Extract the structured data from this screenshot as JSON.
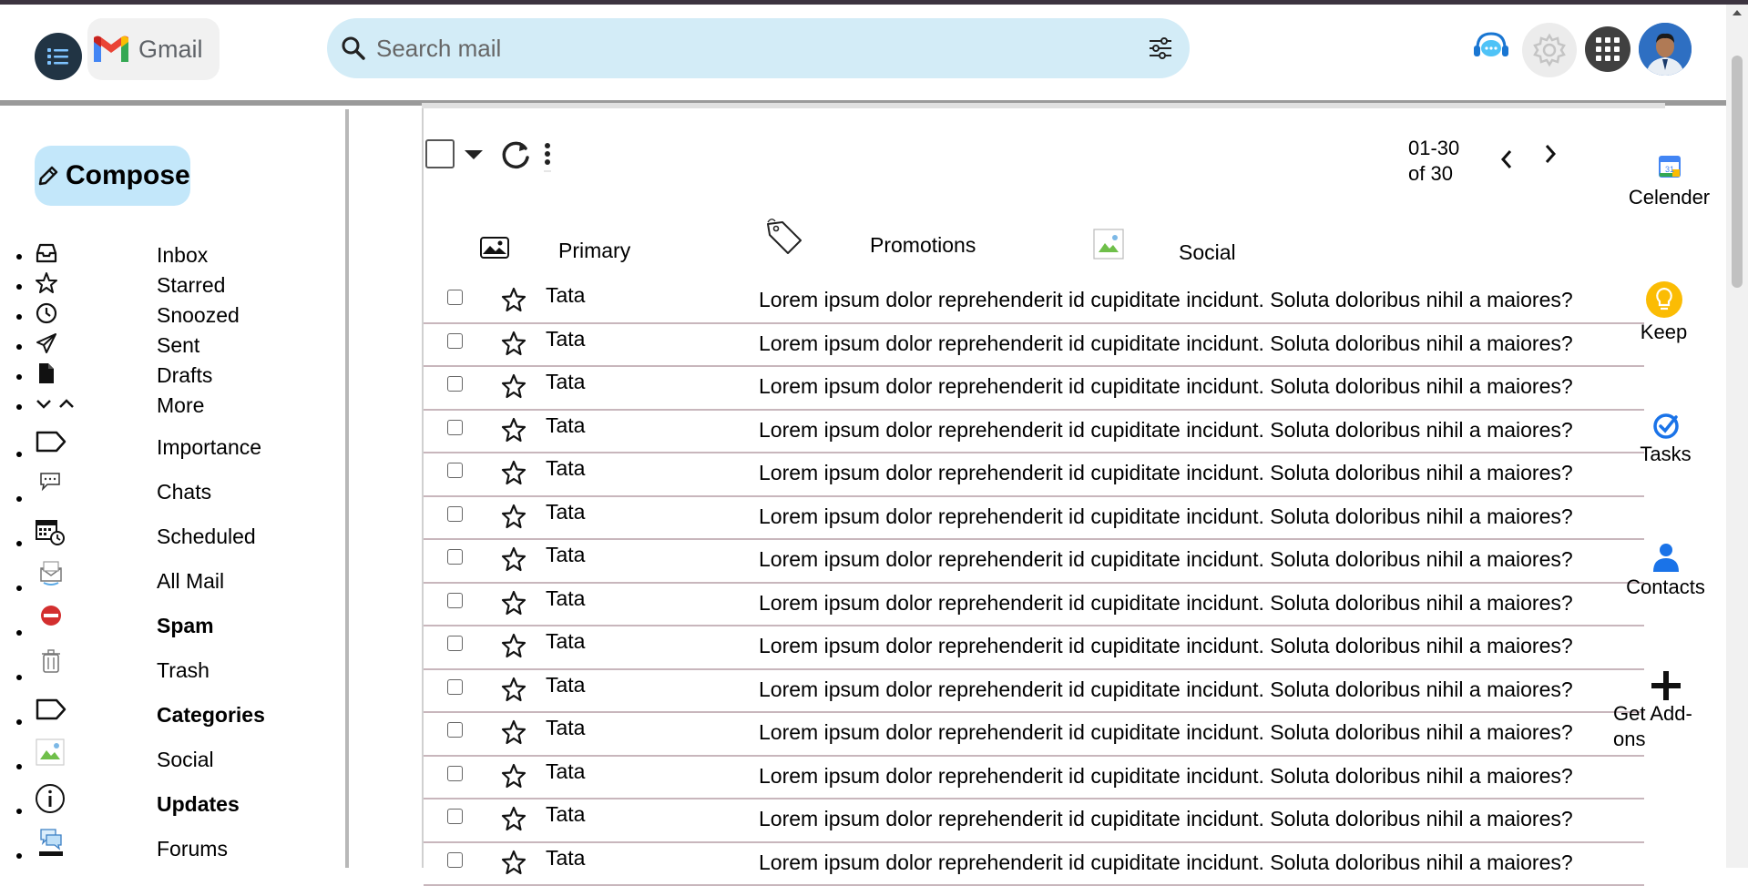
{
  "app": {
    "logo_text": "Gmail"
  },
  "search": {
    "placeholder": "Search mail",
    "value": ""
  },
  "compose": {
    "label": "Compose"
  },
  "sidebar": {
    "items": [
      {
        "label": "Inbox",
        "icon": "inbox-icon",
        "bold": false
      },
      {
        "label": "Starred",
        "icon": "star-icon",
        "bold": false
      },
      {
        "label": "Snoozed",
        "icon": "clock-icon",
        "bold": false
      },
      {
        "label": "Sent",
        "icon": "send-icon",
        "bold": false
      },
      {
        "label": "Drafts",
        "icon": "file-icon",
        "bold": false
      },
      {
        "label": "More",
        "icon": "chevron-toggle-icon",
        "bold": false
      },
      {
        "label": "Importance",
        "icon": "label-icon",
        "bold": false
      },
      {
        "label": "Chats",
        "icon": "chat-icon",
        "bold": false
      },
      {
        "label": "Scheduled",
        "icon": "calendar-clock-icon",
        "bold": false
      },
      {
        "label": "All Mail",
        "icon": "all-mail-icon",
        "bold": false
      },
      {
        "label": "Spam",
        "icon": "spam-icon",
        "bold": true
      },
      {
        "label": "Trash",
        "icon": "trash-icon",
        "bold": false
      },
      {
        "label": "Categories",
        "icon": "label-icon",
        "bold": true
      },
      {
        "label": "Social",
        "icon": "broken-image-icon",
        "bold": false
      },
      {
        "label": "Updates",
        "icon": "info-icon",
        "bold": true
      },
      {
        "label": "Forums",
        "icon": "forums-icon",
        "bold": false
      }
    ]
  },
  "toolbar": {
    "pager_range": "01-30",
    "pager_total": "of 30"
  },
  "tabs": [
    {
      "label": "Primary",
      "icon": "image-icon"
    },
    {
      "label": "Promotions",
      "icon": "tag-icon"
    },
    {
      "label": "Social",
      "icon": "broken-image-icon"
    }
  ],
  "emails": [
    {
      "sender": "Tata",
      "subject": "Lorem ipsum dolor reprehenderit id cupiditate incidunt. Soluta doloribus nihil a maiores?"
    },
    {
      "sender": "Tata",
      "subject": "Lorem ipsum dolor reprehenderit id cupiditate incidunt. Soluta doloribus nihil a maiores?"
    },
    {
      "sender": "Tata",
      "subject": "Lorem ipsum dolor reprehenderit id cupiditate incidunt. Soluta doloribus nihil a maiores?"
    },
    {
      "sender": "Tata",
      "subject": "Lorem ipsum dolor reprehenderit id cupiditate incidunt. Soluta doloribus nihil a maiores?"
    },
    {
      "sender": "Tata",
      "subject": "Lorem ipsum dolor reprehenderit id cupiditate incidunt. Soluta doloribus nihil a maiores?"
    },
    {
      "sender": "Tata",
      "subject": "Lorem ipsum dolor reprehenderit id cupiditate incidunt. Soluta doloribus nihil a maiores?"
    },
    {
      "sender": "Tata",
      "subject": "Lorem ipsum dolor reprehenderit id cupiditate incidunt. Soluta doloribus nihil a maiores?"
    },
    {
      "sender": "Tata",
      "subject": "Lorem ipsum dolor reprehenderit id cupiditate incidunt. Soluta doloribus nihil a maiores?"
    },
    {
      "sender": "Tata",
      "subject": "Lorem ipsum dolor reprehenderit id cupiditate incidunt. Soluta doloribus nihil a maiores?"
    },
    {
      "sender": "Tata",
      "subject": "Lorem ipsum dolor reprehenderit id cupiditate incidunt. Soluta doloribus nihil a maiores?"
    },
    {
      "sender": "Tata",
      "subject": "Lorem ipsum dolor reprehenderit id cupiditate incidunt. Soluta doloribus nihil a maiores?"
    },
    {
      "sender": "Tata",
      "subject": "Lorem ipsum dolor reprehenderit id cupiditate incidunt. Soluta doloribus nihil a maiores?"
    },
    {
      "sender": "Tata",
      "subject": "Lorem ipsum dolor reprehenderit id cupiditate incidunt. Soluta doloribus nihil a maiores?"
    },
    {
      "sender": "Tata",
      "subject": "Lorem ipsum dolor reprehenderit id cupiditate incidunt. Soluta doloribus nihil a maiores?"
    }
  ],
  "right_panel": [
    {
      "label": "Celender",
      "icon": "calendar-icon"
    },
    {
      "label": "Keep",
      "icon": "keep-bulb-icon"
    },
    {
      "label": "Tasks",
      "icon": "tasks-icon"
    },
    {
      "label": "Contacts",
      "icon": "contacts-icon"
    },
    {
      "label": "Get Add-ons",
      "icon": "plus-icon"
    }
  ],
  "colors": {
    "search_bg": "#d3ecf7",
    "compose_bg": "#c3e7fa",
    "menu_btn": "#213444",
    "row_border": "#c8b6bc"
  }
}
